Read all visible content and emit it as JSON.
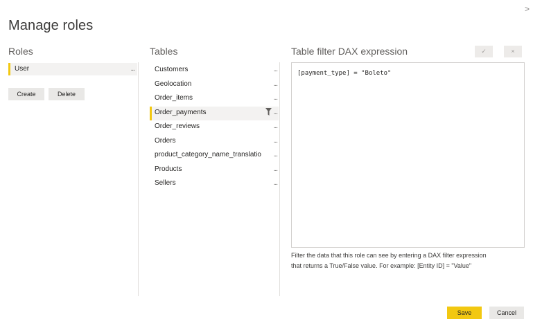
{
  "dialog": {
    "title": "Manage roles",
    "close_glyph": ">"
  },
  "roles": {
    "header": "Roles",
    "items": [
      {
        "label": "User",
        "more": "..."
      }
    ],
    "create_label": "Create",
    "delete_label": "Delete"
  },
  "tables": {
    "header": "Tables",
    "more": "...",
    "items": [
      "Customers",
      "Geolocation",
      "Order_items",
      "Order_payments",
      "Order_reviews",
      "Orders",
      "product_category_name_translatio",
      "Products",
      "Sellers"
    ],
    "selected": "Order_payments"
  },
  "dax": {
    "header": "Table filter DAX expression",
    "apply_glyph": "✓",
    "cancel_glyph": "×",
    "expression": "[payment_type] = \"Boleto\"",
    "help_line_1": "Filter the data that this role can see by entering a DAX filter expression",
    "help_line_2": "that returns a True/False value. For example: [Entity ID] = \"Value\""
  },
  "footer": {
    "save_label": "Save",
    "cancel_label": "Cancel"
  },
  "colors": {
    "accent": "#f2c811",
    "selected_bg": "#f3f2f1",
    "button_bg": "#e9e8e6",
    "border": "#d2d0ce"
  },
  "icons": {
    "filter": "filter-icon",
    "more": "ellipsis-icon",
    "check": "check-icon",
    "close": "close-icon"
  }
}
